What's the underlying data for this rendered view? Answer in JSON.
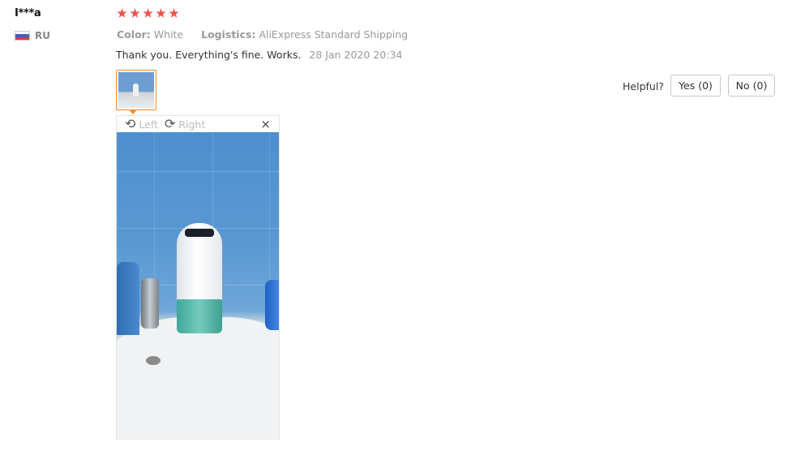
{
  "review": {
    "user_name": "I***a",
    "country_code": "RU",
    "rating": 5,
    "attributes": [
      {
        "key": "Color:",
        "value": "White"
      },
      {
        "key": "Logistics:",
        "value": "AliExpress Standard Shipping"
      }
    ],
    "text": "Thank you. Everything's fine. Works.",
    "date": "28 Jan 2020 20:34"
  },
  "viewer": {
    "rotate_left_label": "Left",
    "rotate_right_label": "Right",
    "close_symbol": "×"
  },
  "helpful": {
    "label": "Helpful?",
    "yes_label": "Yes (0)",
    "no_label": "No (0)"
  },
  "colors": {
    "star": "#f0524a",
    "accent_border": "#f08b26"
  }
}
